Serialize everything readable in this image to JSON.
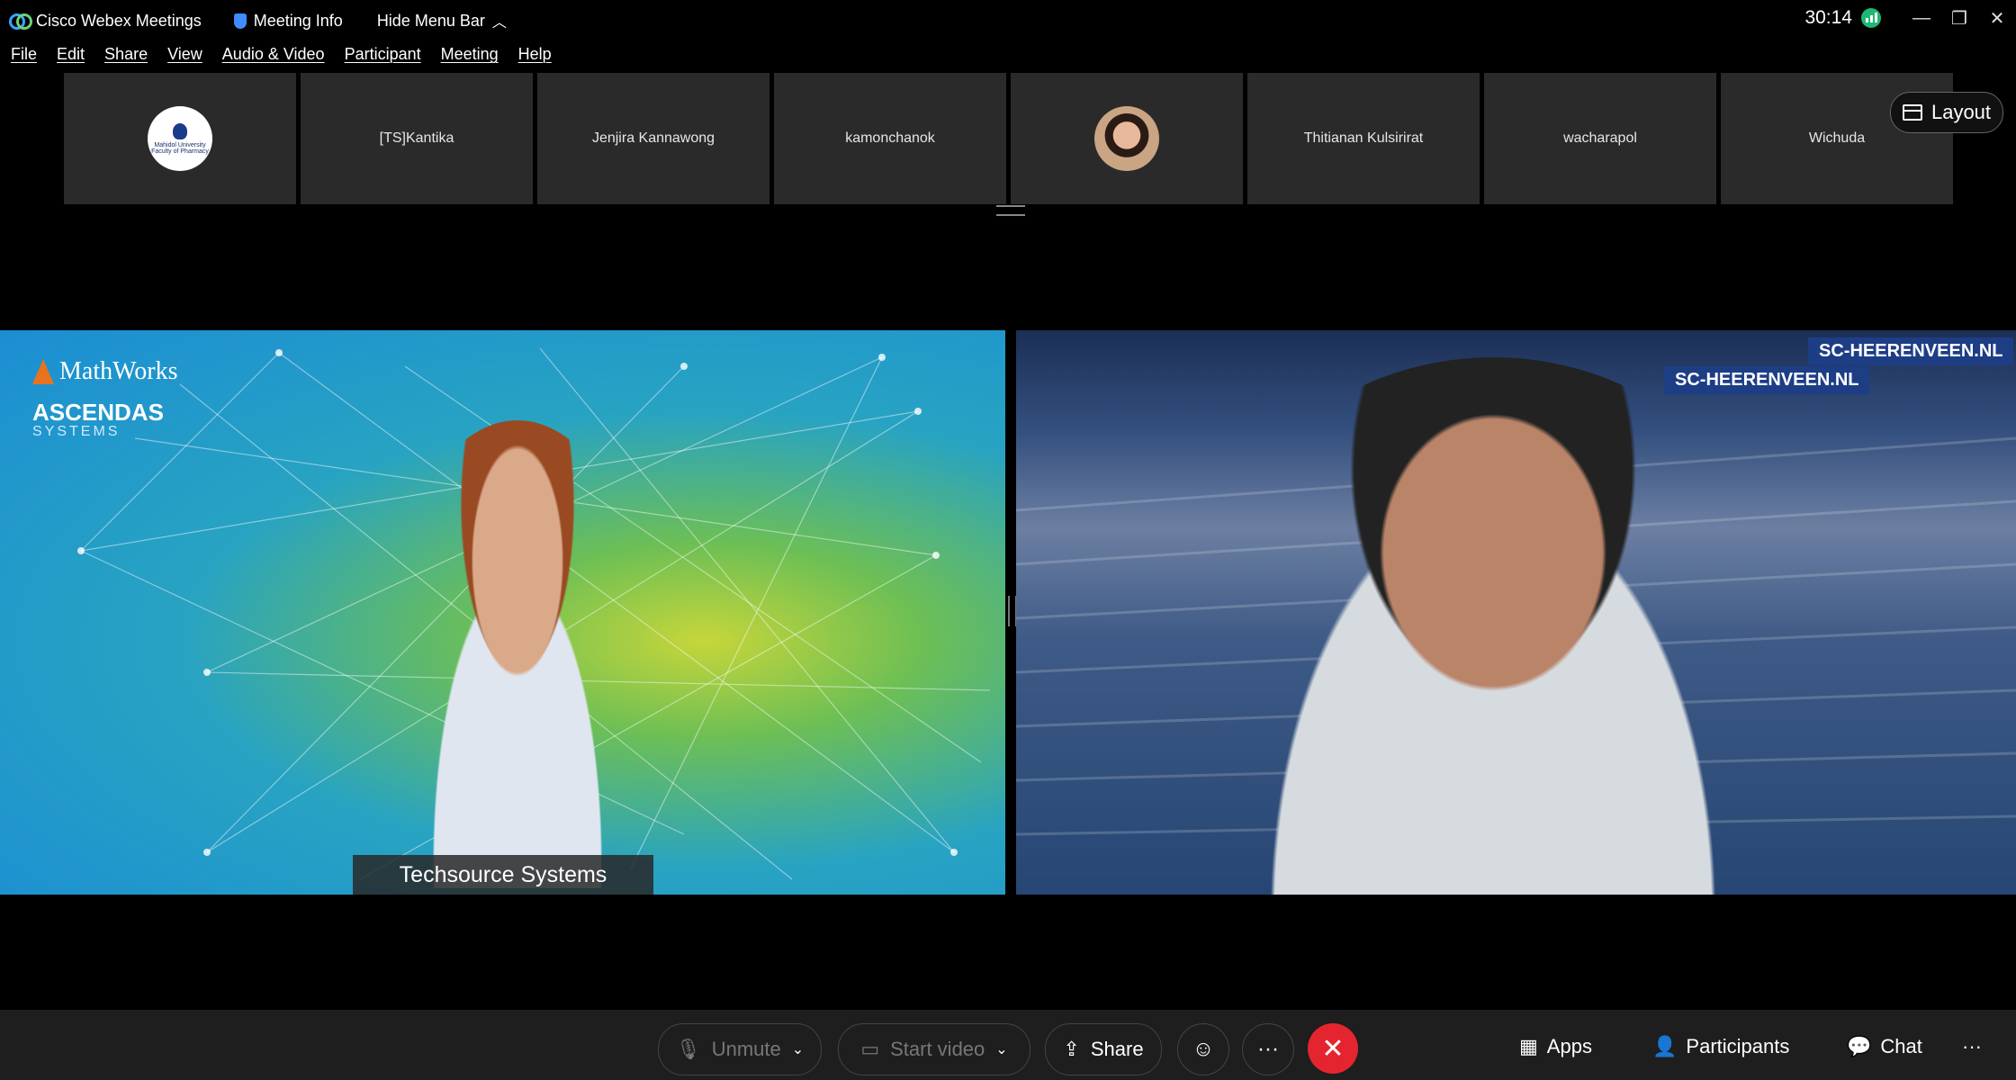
{
  "titlebar": {
    "app_title": "Cisco Webex Meetings",
    "meeting_info": "Meeting Info",
    "hide_menu": "Hide Menu Bar",
    "timer": "30:14"
  },
  "menu": [
    "File",
    "Edit",
    "Share",
    "View",
    "Audio & Video",
    "Participant",
    "Meeting",
    "Help"
  ],
  "participants_strip": [
    {
      "name": "",
      "type": "logo-avatar"
    },
    {
      "name": "[TS]Kantika"
    },
    {
      "name": "Jenjira Kannawong"
    },
    {
      "name": "kamonchanok"
    },
    {
      "name": "",
      "type": "photo-avatar"
    },
    {
      "name": "Thitianan Kulsirirat"
    },
    {
      "name": "wacharapol"
    },
    {
      "name": "Wichuda"
    }
  ],
  "avatar_logo_text": {
    "line1": "Mahidol University",
    "line2": "Faculty of Pharmacy"
  },
  "layout_button": "Layout",
  "video_left": {
    "brand1": "MathWorks",
    "brand2": "ASCENDAS",
    "brand3": "SYSTEMS",
    "name_label": "Techsource Systems"
  },
  "video_right": {
    "banner": "SC-HEERENVEEN.NL"
  },
  "controls": {
    "unmute": "Unmute",
    "start_video": "Start video",
    "share": "Share",
    "apps": "Apps",
    "participants": "Participants",
    "chat": "Chat",
    "more": "···",
    "reactions_icon": "reaction-icon",
    "leave_icon": "close-icon"
  },
  "colors": {
    "leave": "#e4252f",
    "signal": "#1fb874",
    "tile_bg": "#2a2a2a",
    "control_bar": "#1e1e1e"
  }
}
